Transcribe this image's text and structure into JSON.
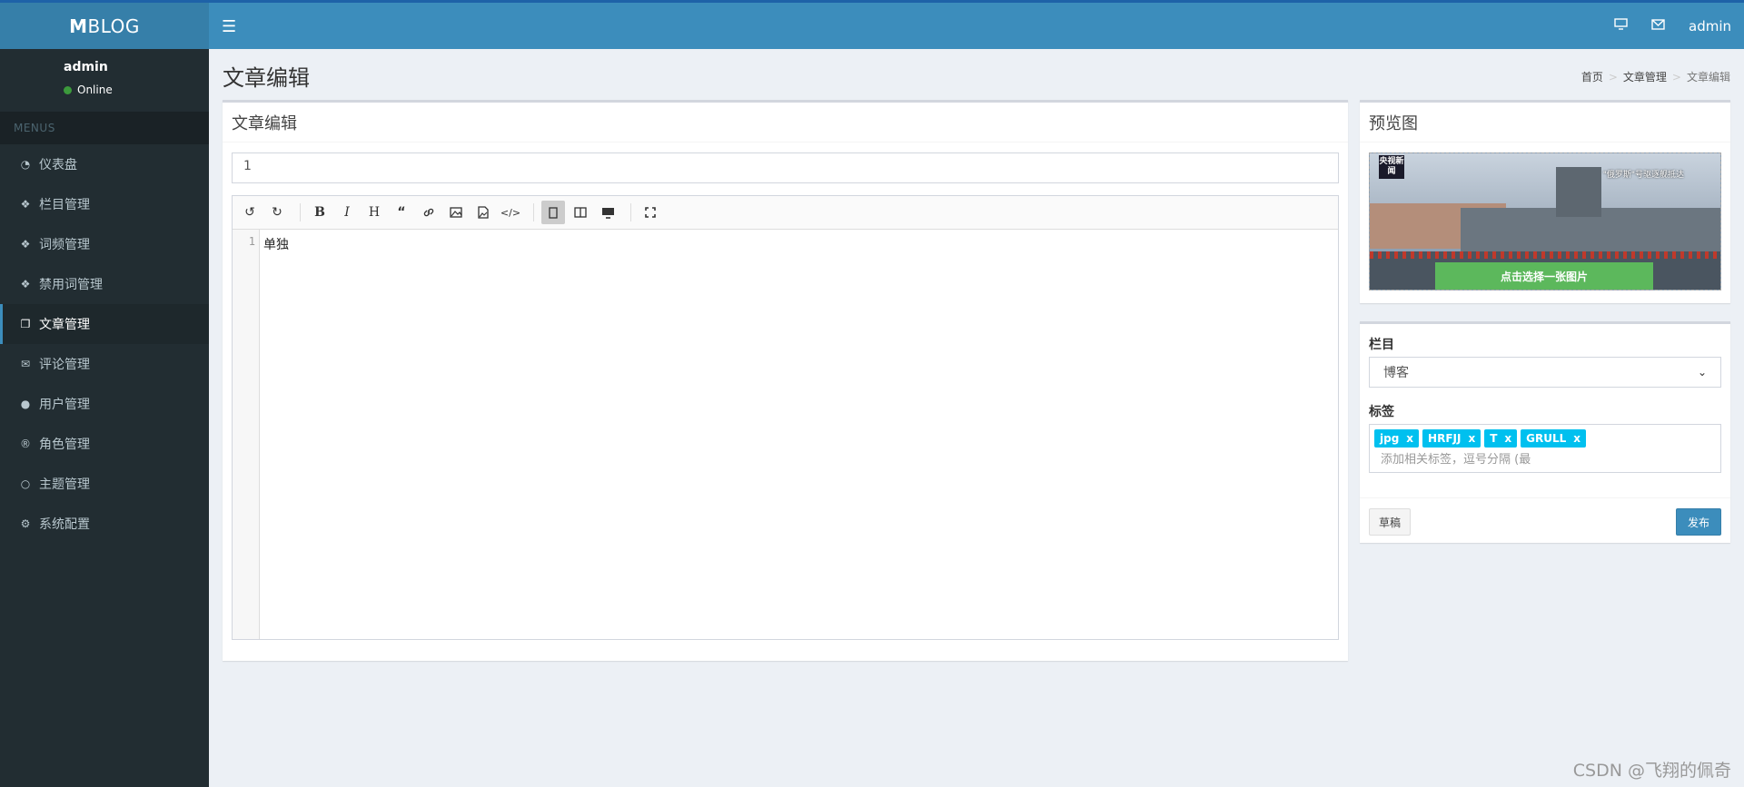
{
  "app": {
    "logo_strong": "M",
    "logo_rest": "BLOG"
  },
  "header": {
    "user": "admin"
  },
  "sidebar": {
    "user_name": "admin",
    "status": "Online",
    "menu_header": "MENUS",
    "items": [
      {
        "label": "仪表盘",
        "icon": "dashboard-icon"
      },
      {
        "label": "栏目管理",
        "icon": "tags-icon"
      },
      {
        "label": "词频管理",
        "icon": "tags-icon"
      },
      {
        "label": "禁用词管理",
        "icon": "tags-icon"
      },
      {
        "label": "文章管理",
        "icon": "copy-icon",
        "active": true
      },
      {
        "label": "评论管理",
        "icon": "comments-icon"
      },
      {
        "label": "用户管理",
        "icon": "user-icon"
      },
      {
        "label": "角色管理",
        "icon": "registered-icon"
      },
      {
        "label": "主题管理",
        "icon": "circle-icon"
      },
      {
        "label": "系统配置",
        "icon": "gear-icon"
      }
    ]
  },
  "page": {
    "title": "文章编辑",
    "breadcrumb": [
      "首页",
      "文章管理",
      "文章编辑"
    ]
  },
  "editor_box": {
    "title": "文章编辑",
    "title_input_value": "1",
    "line_number": "1",
    "content": "单独"
  },
  "preview_box": {
    "title": "预览图",
    "pick_button": "点击选择一张图片",
    "news_logo": "央视新闻",
    "news_caption": "\"俄罗斯\"号驱逐舰抵达"
  },
  "meta_box": {
    "category_label": "栏目",
    "category_value": "博客",
    "tags_label": "标签",
    "tags": [
      "jpg",
      "HRFJJ",
      "T",
      "GRULL"
    ],
    "tag_remove": "x",
    "tags_placeholder": "添加相关标签，逗号分隔 (最",
    "draft_button": "草稿",
    "publish_button": "发布"
  },
  "watermark": "CSDN @飞翔的佩奇",
  "colors": {
    "header": "#3c8dbc",
    "sidebar": "#222d32",
    "publish": "#3c8dbc",
    "tag": "#00c0ef",
    "pick": "#5cb85c"
  }
}
